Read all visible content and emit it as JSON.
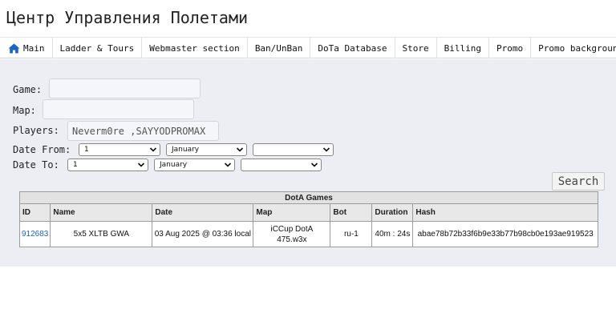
{
  "page_title": "Центр Управления Полетами",
  "nav": {
    "items": [
      {
        "label": "Main",
        "icon": "home-icon"
      },
      {
        "label": "Ladder & Tours"
      },
      {
        "label": "Webmaster section"
      },
      {
        "label": "Ban/UnBan"
      },
      {
        "label": "DoTa Database"
      },
      {
        "label": "Store"
      },
      {
        "label": "Billing"
      },
      {
        "label": "Promo"
      },
      {
        "label": "Promo background"
      }
    ]
  },
  "form": {
    "game_label": "Game:",
    "game_value": "",
    "map_label": "Map:",
    "map_value": "",
    "players_label": "Players:",
    "players_value": "Neverm0re ,SAYYODPROMAX",
    "date_from_label": "Date From:",
    "date_from_day": "1",
    "date_from_month": "January",
    "date_from_year": "",
    "date_to_label": "Date To:",
    "date_to_day": "1",
    "date_to_month": "January",
    "date_to_year": "",
    "search_label": "Search"
  },
  "table": {
    "caption": "DotA Games",
    "columns": [
      "ID",
      "Name",
      "Date",
      "Map",
      "Bot",
      "Duration",
      "Hash"
    ],
    "rows": [
      {
        "id": "912683",
        "name": "5x5 XLTB GWA",
        "date": "03 Aug 2025 @ 03:36 local",
        "map_line1": "iCCup DotA",
        "map_line2": "475.w3x",
        "bot": "ru-1",
        "duration": "40m : 24s",
        "hash": "abae78b72b33f6b9e33b77b98cb0e193ae919523"
      }
    ]
  },
  "colors": {
    "panel_bg": "#eceef4",
    "link": "#1a66c2",
    "home_icon": "#1a66c2"
  }
}
